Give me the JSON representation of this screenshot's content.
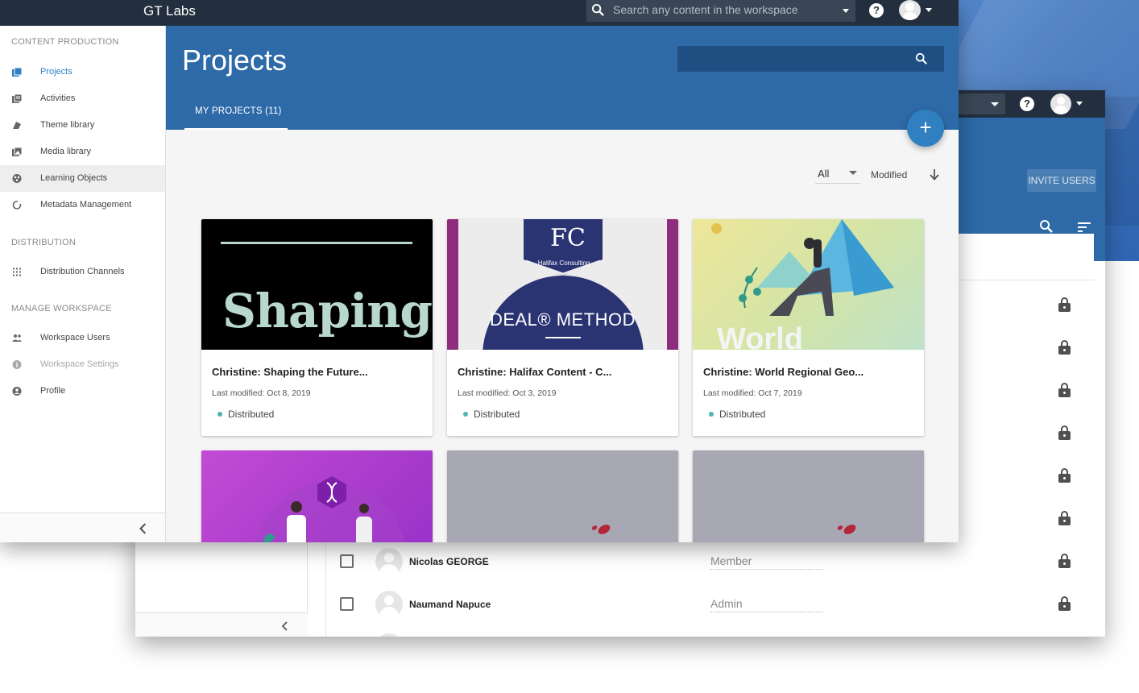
{
  "colors": {
    "topbar": "#232f3e",
    "header_blue": "#2d6aa7",
    "accent": "#2f7fc1",
    "status_distributed": "#4db6ac"
  },
  "topbar": {
    "brand": "GT Labs",
    "search_placeholder": "Search any content in the workspace",
    "help_icon": "help-circle-icon"
  },
  "sidebar": {
    "sections": [
      {
        "heading": "CONTENT PRODUCTION",
        "items": [
          {
            "label": "Projects",
            "icon": "projects-icon",
            "selected": true
          },
          {
            "label": "Activities",
            "icon": "activities-icon"
          },
          {
            "label": "Theme library",
            "icon": "theme-icon"
          },
          {
            "label": "Media library",
            "icon": "media-icon"
          },
          {
            "label": "Learning Objects",
            "icon": "learning-objects-icon",
            "highlighted": true
          },
          {
            "label": "Metadata Management",
            "icon": "metadata-icon"
          }
        ]
      },
      {
        "heading": "DISTRIBUTION",
        "items": [
          {
            "label": "Distribution Channels",
            "icon": "grid-icon"
          }
        ]
      },
      {
        "heading": "MANAGE WORKSPACE",
        "items": [
          {
            "label": "Workspace Users",
            "icon": "users-icon"
          },
          {
            "label": "Workspace Settings",
            "icon": "info-icon",
            "disabled": true
          },
          {
            "label": "Profile",
            "icon": "profile-icon"
          }
        ]
      }
    ]
  },
  "main": {
    "title": "Projects",
    "tab_label": "MY PROJECTS (11)",
    "fab_label": "+",
    "filter_value": "All",
    "sort_label": "Modified",
    "cards": [
      {
        "title": "Christine: Shaping the Future...",
        "modified": "Last modified: Oct 8, 2019",
        "status": "Distributed",
        "thumb_text": "Shaping"
      },
      {
        "title": "Christine: Halifax Content - C...",
        "modified": "Last modified: Oct 3, 2019",
        "status": "Distributed",
        "thumb_text": "DEAL® METHOD",
        "thumb_logo": "Halifax Consulting"
      },
      {
        "title": "Christine: World Regional Geo...",
        "modified": "Last modified: Oct 7, 2019",
        "status": "Distributed",
        "thumb_text": "World"
      }
    ]
  },
  "back_window": {
    "invite_label": "INVITE USERS",
    "users": [
      {
        "name": "Nicolas GEORGE",
        "role": "Member"
      },
      {
        "name": "Naumand Napuce",
        "role": "Admin"
      }
    ]
  }
}
